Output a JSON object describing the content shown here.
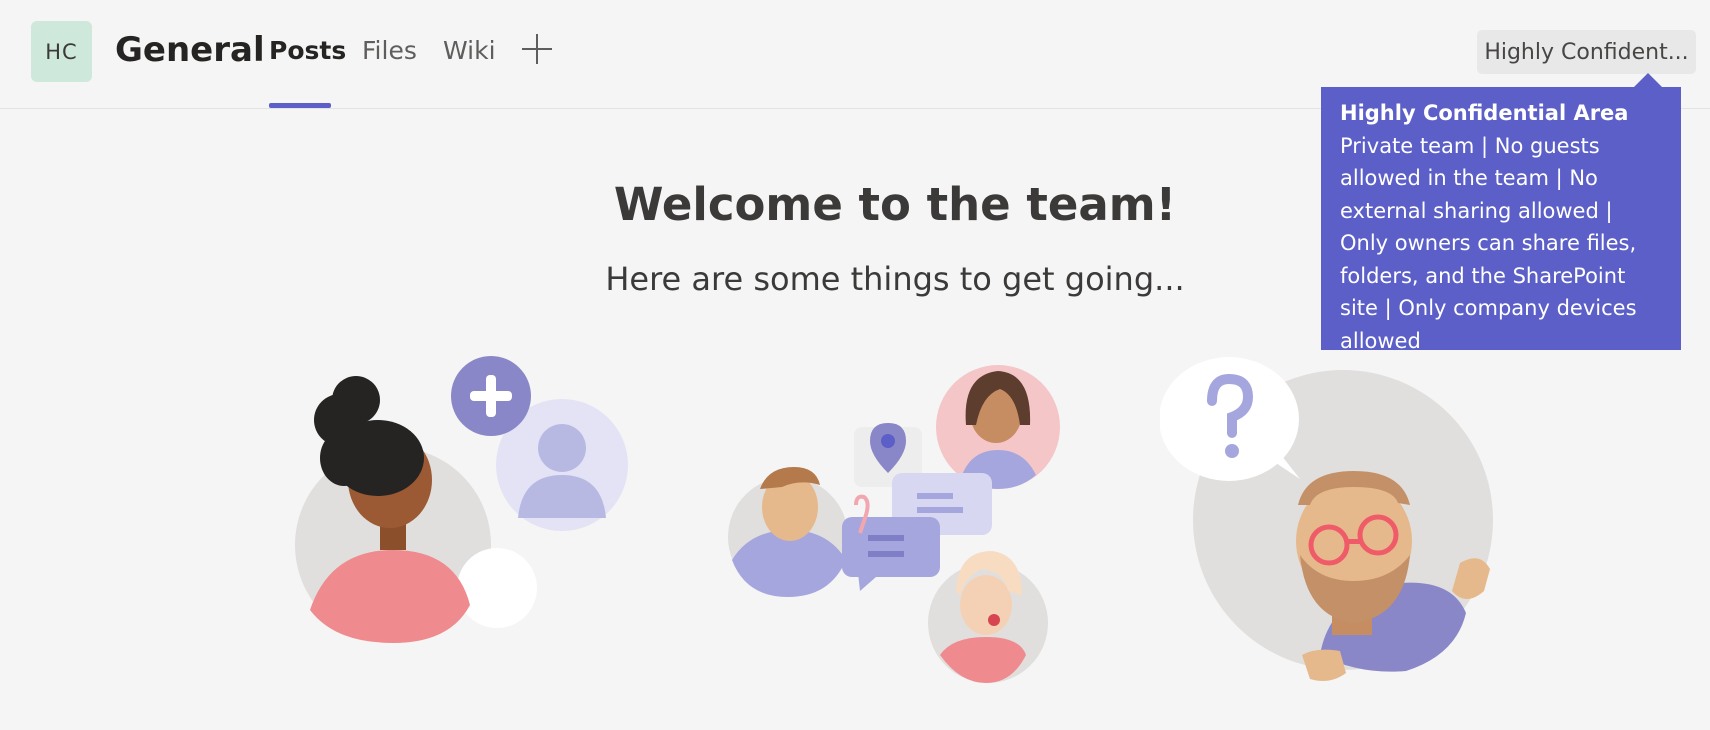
{
  "team": {
    "initials": "HC",
    "channel": "General"
  },
  "tabs": [
    {
      "label": "Posts",
      "active": true
    },
    {
      "label": "Files",
      "active": false
    },
    {
      "label": "Wiki",
      "active": false
    }
  ],
  "sensitivity_label": {
    "button_text": "Highly Confident...",
    "tooltip_title": "Highly Confidential Area",
    "tooltip_body": "Private team | No guests allowed in the team | No external sharing allowed | Only owners can share files, folders, and the SharePoint site | Only company devices allowed"
  },
  "welcome": {
    "title": "Welcome to the team!",
    "subtitle": "Here are some things to get going..."
  },
  "colors": {
    "accent": "#5b5fc7",
    "avatar_bg": "#cfe8dc",
    "background": "#f5f5f5"
  },
  "icons": [
    "add-tab-icon",
    "add-member-plus-icon",
    "question-icon",
    "location-pin-icon",
    "chat-bubble-icon",
    "paperclip-icon"
  ]
}
